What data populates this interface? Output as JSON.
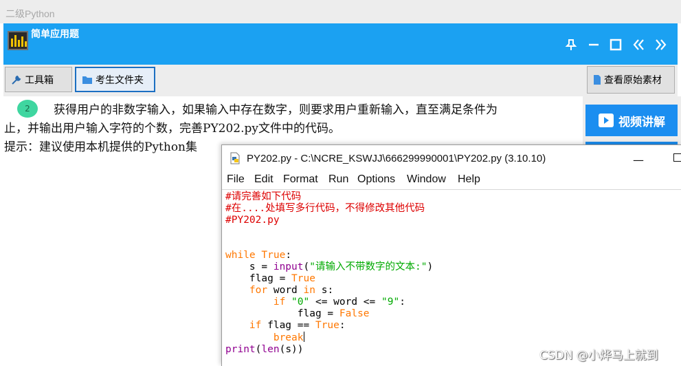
{
  "app": {
    "title": "二级Python"
  },
  "header": {
    "title": "简单应用题",
    "icons": [
      "pin-icon",
      "minimize-icon",
      "maximize-icon",
      "double-left-icon",
      "double-right-icon"
    ]
  },
  "toolbar": {
    "toolbox_label": "工具箱",
    "exam_folder_label": "考生文件夹",
    "view_materials_label": "查看原始素材"
  },
  "side": {
    "video_label": "视频讲解"
  },
  "question": {
    "number": "2",
    "line1": "获得用户的非数字输入，如果输入中存在数字，则要求用户重新输入，直至满足条件为",
    "line2": "止，并输出用户输入字符的个数，完善PY202.py文件中的代码。",
    "line3": "提示：建议使用本机提供的Python集"
  },
  "idle": {
    "title": "PY202.py - C:\\NCRE_KSWJJ\\666299990001\\PY202.py (3.10.10)",
    "menu": [
      "File",
      "Edit",
      "Format",
      "Run",
      "Options",
      "Window",
      "Help"
    ],
    "code": {
      "c1": "#请完善如下代码",
      "c2": "#在....处填写多行代码，不得修改其他代码",
      "c3": "#PY202.py",
      "l1_kw": "while",
      "l1_rest": " ",
      "l1_kw2": "True",
      "l1_end": ":",
      "l2_a": "    s = ",
      "l2_fn": "input",
      "l2_b": "(",
      "l2_str": "\"请输入不带数字的文本:\"",
      "l2_c": ")",
      "l3_a": "    flag = ",
      "l3_kw": "True",
      "l4_ind": "    ",
      "l4_kw": "for",
      "l4_b": " word ",
      "l4_kw2": "in",
      "l4_c": " s:",
      "l5_ind": "        ",
      "l5_kw": "if",
      "l5_s1": " \"0\"",
      "l5_b": " <= word <= ",
      "l5_s2": "\"9\"",
      "l5_c": ":",
      "l6_a": "            flag = ",
      "l6_kw": "False",
      "l7_ind": "    ",
      "l7_kw": "if",
      "l7_b": " flag == ",
      "l7_kw2": "True",
      "l7_c": ":",
      "l8_ind": "        ",
      "l8_kw": "break",
      "l9_fn": "print",
      "l9_b": "(",
      "l9_fn2": "len",
      "l9_c": "(s))"
    }
  },
  "watermark": "CSDN @小烨马上就到",
  "colors": {
    "header_blue": "#1ba1f2",
    "video_blue": "#1b8ef0",
    "keyword": "#ff7700",
    "comment": "#dd0000",
    "builtin": "#900090",
    "string": "#00aa00"
  }
}
